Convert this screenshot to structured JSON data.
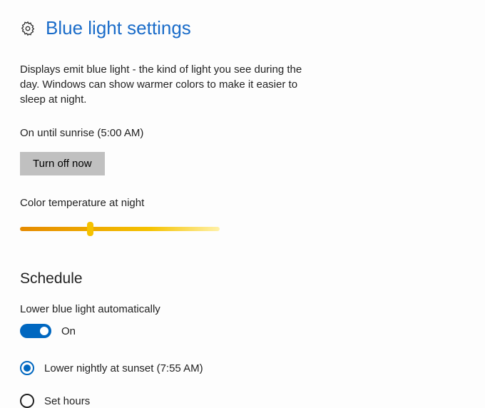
{
  "header": {
    "title": "Blue light settings"
  },
  "description": "Displays emit blue light - the kind of light you see during the day. Windows can show warmer colors to make it easier to sleep at night.",
  "status": "On until sunrise (5:00 AM)",
  "turn_off_button": "Turn off now",
  "slider": {
    "label": "Color temperature at night"
  },
  "schedule": {
    "heading": "Schedule",
    "auto_label": "Lower blue light automatically",
    "toggle_state": "On",
    "options": [
      {
        "label": "Lower nightly at sunset (7:55 AM)",
        "selected": true
      },
      {
        "label": "Set hours",
        "selected": false
      }
    ]
  }
}
